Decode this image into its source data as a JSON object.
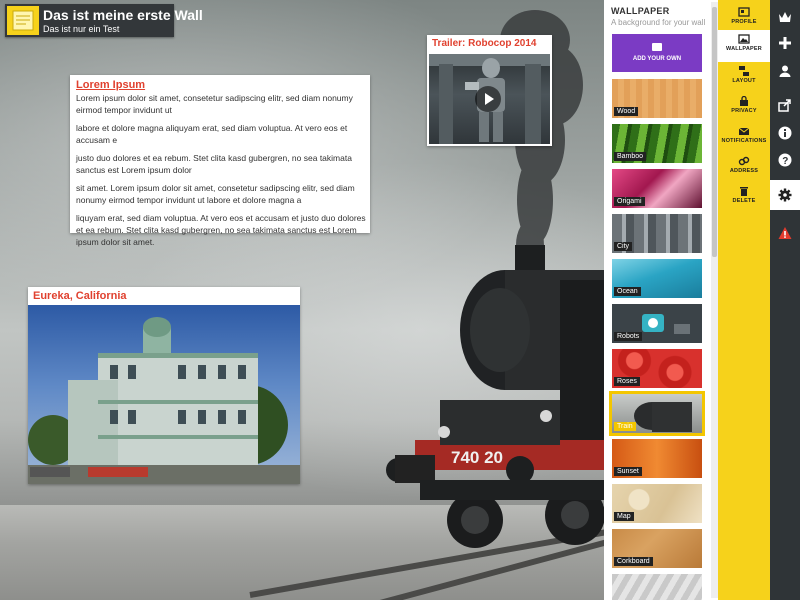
{
  "wall": {
    "title": "Das ist meine erste Wall",
    "subtitle": "Das ist nur ein Test",
    "engine_number": "740 20"
  },
  "posts": {
    "lorem": {
      "title": "Lorem Ipsum",
      "paragraphs": [
        "Lorem ipsum dolor sit amet, consetetur sadipscing elitr, sed diam nonumy eirmod tempor invidunt ut",
        "labore et dolore magna aliquyam erat, sed diam voluptua. At vero eos et accusam e",
        " justo duo dolores et ea rebum. Stet clita kasd gubergren, no sea takimata sanctus est Lorem ipsum dolor",
        "sit amet. Lorem ipsum dolor sit amet, consetetur sadipscing elitr, sed diam nonumy eirmod tempor invidunt ut labore et dolore magna a",
        "liquyam erat, sed diam voluptua. At vero eos et accusam et justo duo dolores et ea rebum. Stet clita kasd gubergren, no sea takimata sanctus est Lorem ipsum dolor sit amet."
      ]
    },
    "video": {
      "title": "Trailer: Robocop 2014"
    },
    "photo": {
      "title": "Eureka, California"
    }
  },
  "wallpaper_panel": {
    "title": "WALLPAPER",
    "subtitle": "A background for your wall",
    "add_own_label": "ADD YOUR OWN",
    "items": [
      {
        "label": "Wood",
        "color": "#e6a35c"
      },
      {
        "label": "Bamboo",
        "color": "#4f9a2a"
      },
      {
        "label": "Origami",
        "color": "#c42f6b"
      },
      {
        "label": "City",
        "color": "#7b8389"
      },
      {
        "label": "Ocean",
        "color": "#2ea7c4"
      },
      {
        "label": "Robots",
        "color": "#3b4348"
      },
      {
        "label": "Roses",
        "color": "#d8312d"
      },
      {
        "label": "Train",
        "color": "#8d9290"
      },
      {
        "label": "Sunset",
        "color": "#e06a1f"
      },
      {
        "label": "Map",
        "color": "#e8d9b9"
      },
      {
        "label": "Corkboard",
        "color": "#c98b47"
      }
    ],
    "selected": "Train"
  },
  "settings_menu": {
    "items": [
      {
        "label": "PROFILE",
        "icon": "profile-icon"
      },
      {
        "label": "WALLPAPER",
        "icon": "wallpaper-icon"
      },
      {
        "label": "LAYOUT",
        "icon": "layout-icon"
      },
      {
        "label": "PRIVACY",
        "icon": "lock-icon"
      },
      {
        "label": "NOTIFICATIONS",
        "icon": "envelope-icon"
      },
      {
        "label": "ADDRESS",
        "icon": "link-icon"
      },
      {
        "label": "DELETE",
        "icon": "trash-icon"
      }
    ],
    "active": "WALLPAPER"
  },
  "right_bar": {
    "items": [
      "crown-icon",
      "plus-icon",
      "user-icon",
      "share-icon",
      "info-icon",
      "help-icon",
      "gear-icon",
      "warning-icon"
    ],
    "active": "gear-icon"
  },
  "colors": {
    "accent_yellow": "#f6d21b",
    "dark_bar": "#2f3437",
    "post_title_red": "#e0412f",
    "add_own_purple": "#7b3bc4"
  }
}
